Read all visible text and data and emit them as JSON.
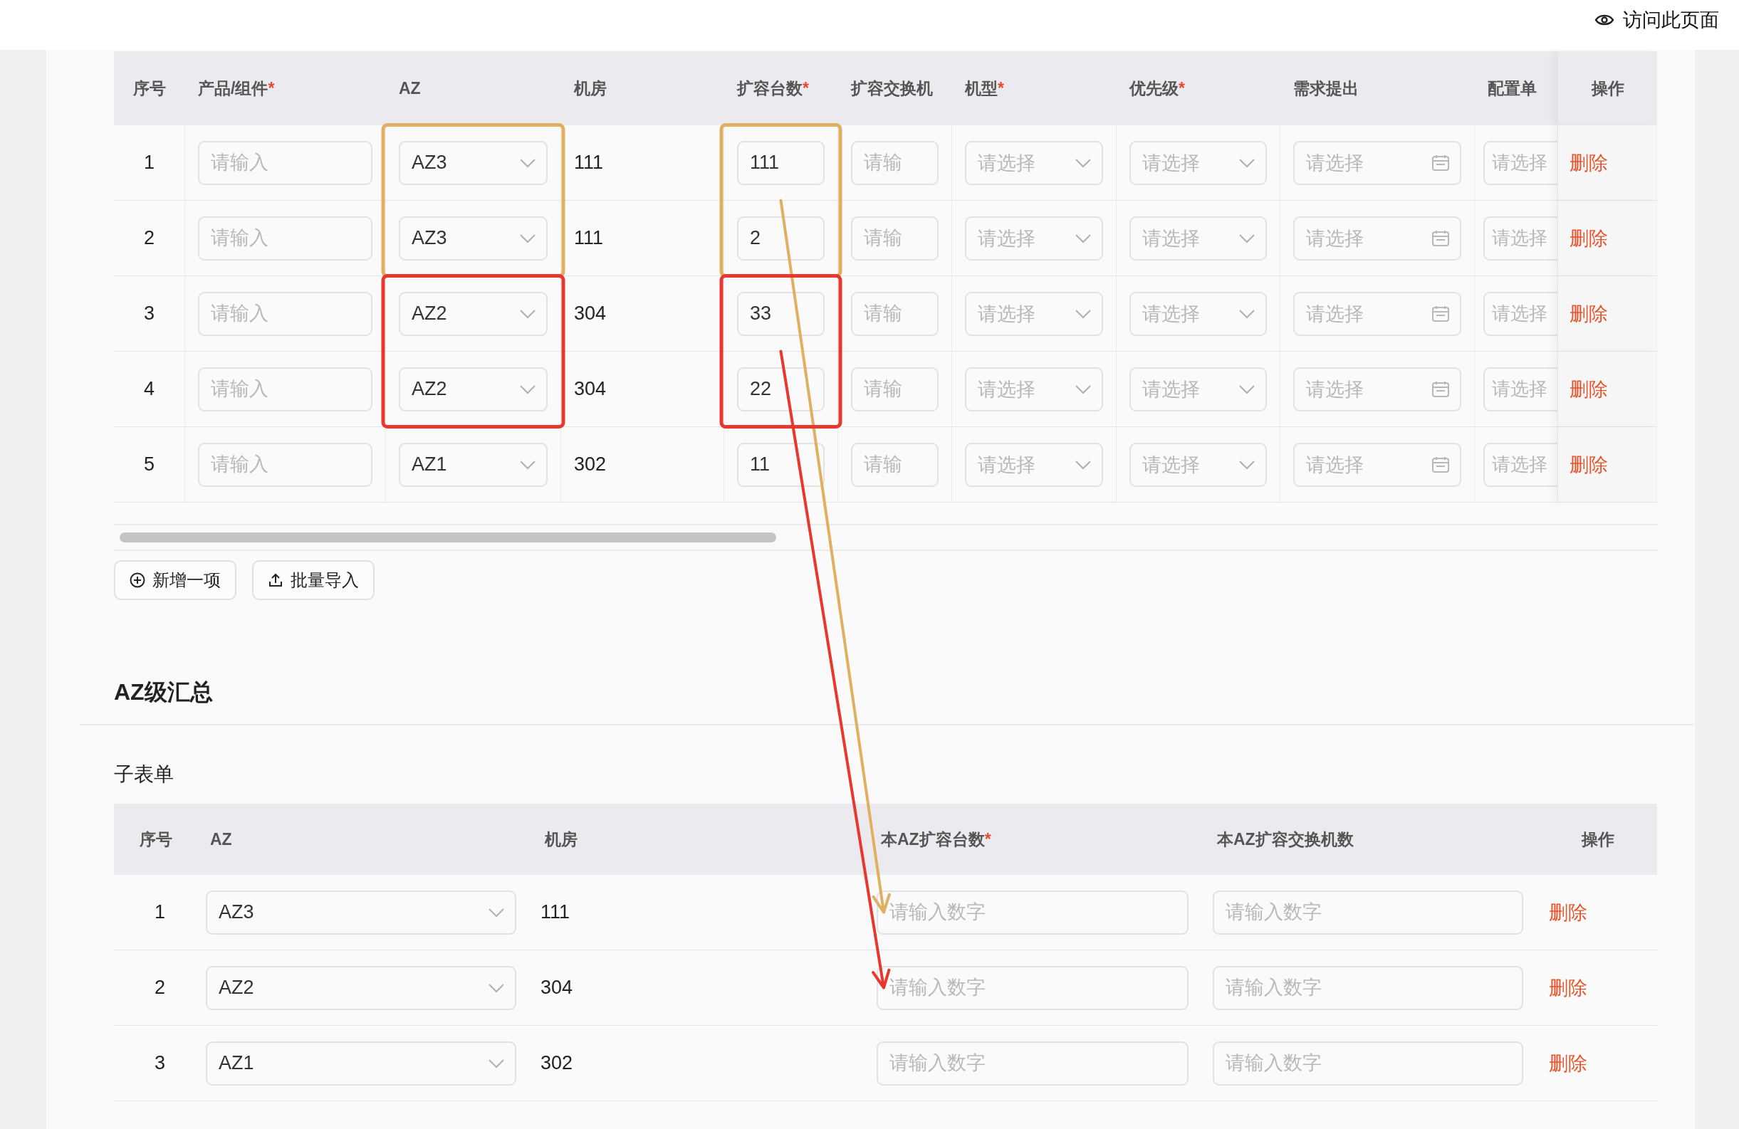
{
  "top_bar": {
    "link": "访问此页面"
  },
  "items_table": {
    "columns": [
      {
        "label": "序号"
      },
      {
        "label": "产品/组件",
        "required_mark": "*"
      },
      {
        "label": "AZ"
      },
      {
        "label": "机房"
      },
      {
        "label": "扩容台数",
        "required_mark": "*"
      },
      {
        "label": "扩容交换机"
      },
      {
        "label": "机型",
        "required_mark": "*"
      },
      {
        "label": "优先级",
        "required_mark": "*"
      },
      {
        "label": "需求提出"
      },
      {
        "label": "配置单"
      },
      {
        "label": "操作"
      }
    ],
    "rows": [
      {
        "no": "1",
        "product_placeholder": "请输入",
        "az": "AZ3",
        "room": "111",
        "count": "111",
        "switch_placeholder": "请输",
        "model_placeholder": "请选择",
        "priority_placeholder": "请选择",
        "request_placeholder": "请选择",
        "config_placeholder": "请选择",
        "action": "删除",
        "color": "#e0b062"
      },
      {
        "no": "2",
        "product_placeholder": "请输入",
        "az": "AZ3",
        "room": "111",
        "count": "2",
        "switch_placeholder": "请输",
        "model_placeholder": "请选择",
        "priority_placeholder": "请选择",
        "request_placeholder": "请选择",
        "config_placeholder": "请选择",
        "action": "删除",
        "color": "#e0b062"
      },
      {
        "no": "3",
        "product_placeholder": "请输入",
        "az": "AZ2",
        "room": "304",
        "count": "33",
        "switch_placeholder": "请输",
        "model_placeholder": "请选择",
        "priority_placeholder": "请选择",
        "request_placeholder": "请选择",
        "config_placeholder": "请选择",
        "action": "删除",
        "color": "#e8372c"
      },
      {
        "no": "4",
        "product_placeholder": "请输入",
        "az": "AZ2",
        "room": "304",
        "count": "22",
        "switch_placeholder": "请输",
        "model_placeholder": "请选择",
        "priority_placeholder": "请选择",
        "request_placeholder": "请选择",
        "config_placeholder": "请选择",
        "action": "删除",
        "color": "#e8372c"
      },
      {
        "no": "5",
        "product_placeholder": "请输入",
        "az": "AZ1",
        "room": "302",
        "count": "11",
        "switch_placeholder": "请输",
        "model_placeholder": "请选择",
        "priority_placeholder": "请选择",
        "request_placeholder": "请选择",
        "config_placeholder": "请选择",
        "action": "删除"
      }
    ]
  },
  "buttons": [
    {
      "kind": "add",
      "label": "新增一项"
    },
    {
      "kind": "import",
      "label": "批量导入"
    }
  ],
  "section_title": "AZ级汇总",
  "subform": {
    "title": "子表单",
    "columns": [
      {
        "label": "序号"
      },
      {
        "label": "AZ"
      },
      {
        "label": "机房"
      },
      {
        "label": "本AZ扩容台数",
        "required_mark": "*"
      },
      {
        "label": "本AZ扩容交换机数"
      },
      {
        "label": "操作"
      }
    ],
    "rows": [
      {
        "no": "1",
        "az": "AZ3",
        "room": "111",
        "count_placeholder": "请输入数字",
        "switch_placeholder": "请输入数字",
        "action": "删除",
        "color": "#e0b062"
      },
      {
        "no": "2",
        "az": "AZ2",
        "room": "304",
        "count_placeholder": "请输入数字",
        "switch_placeholder": "请输入数字",
        "action": "删除",
        "color": "#e8372c"
      },
      {
        "no": "3",
        "az": "AZ1",
        "room": "302",
        "count_placeholder": "请输入数字",
        "switch_placeholder": "请输入数字",
        "action": "删除"
      }
    ]
  }
}
